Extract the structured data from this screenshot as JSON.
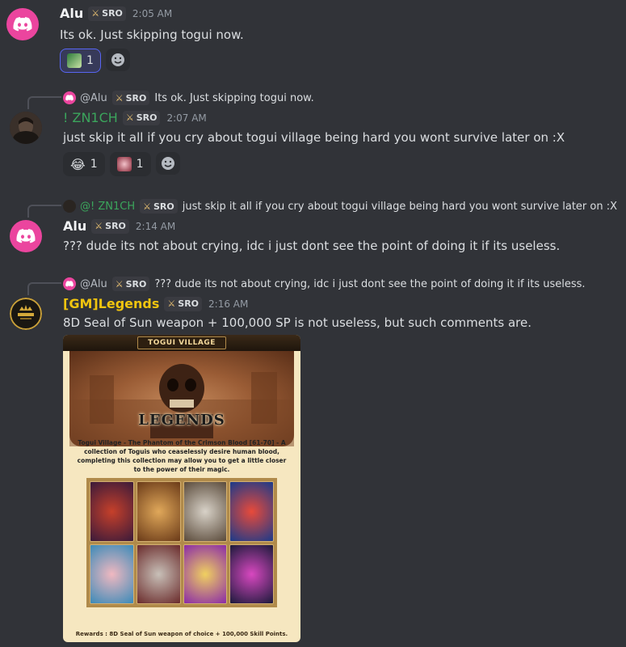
{
  "messages": [
    {
      "username": "Alu",
      "username_color": "#f2f3f5",
      "tag": "SRO",
      "time": "2:05 AM",
      "text": "Its ok. Just skipping togui now.",
      "reactions": [
        {
          "emoji": "custom-emoji",
          "count": "1",
          "active": true
        }
      ]
    },
    {
      "reply": {
        "name": "@Alu",
        "tag": "SRO",
        "text": "Its ok. Just skipping togui now."
      },
      "username": "! ZN1CH",
      "username_color": "#3ba55c",
      "tag": "SRO",
      "time": "2:07 AM",
      "text": "just skip it all if you cry about togui village being hard you wont survive later on :X",
      "reactions": [
        {
          "emoji": "joy-emoji",
          "count": "1"
        },
        {
          "emoji": "custom-emoji",
          "count": "1"
        }
      ]
    },
    {
      "reply": {
        "name": "@! ZN1CH",
        "tag": "SRO",
        "text": "just skip it all if you cry about togui village being hard you wont survive later on :X"
      },
      "username": "Alu",
      "username_color": "#f2f3f5",
      "tag": "SRO",
      "time": "2:14 AM",
      "text": "??? dude its not about crying, idc i just dont see the point of doing it if its useless."
    },
    {
      "reply": {
        "name": "@Alu",
        "tag": "SRO",
        "text": "??? dude its not about crying, idc i just dont see the point of doing it if its useless."
      },
      "username": "[GM]Legends",
      "username_color": "#f0c40f",
      "tag": "SRO",
      "time": "2:16 AM",
      "text": "8D Seal of Sun weapon + 100,000 SP is not useless, but such comments are.",
      "attachment": {
        "banner": "TOGUI VILLAGE",
        "logo": "LEGENDS",
        "description": "Togui Village - The Phantom of the Crimson Blood [61-70] - A collection of Toguis who ceaselessly desire human blood, completing this collection may allow you to get a little closer to the power of their magic.",
        "footer": "Rewards : 8D Seal of Sun weapon of choice + 100,000 Skill Points."
      }
    }
  ],
  "colors": {
    "background": "#313338",
    "discord_avatar": "#eb459e",
    "reaction_active_border": "#5865f2"
  }
}
